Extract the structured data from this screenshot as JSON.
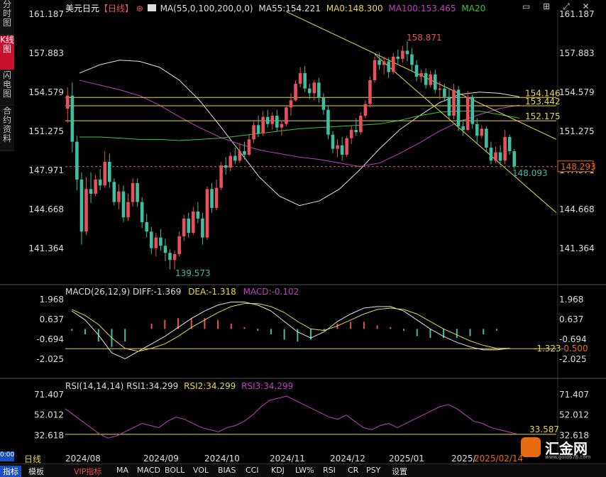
{
  "title": {
    "symbol": "美元日元",
    "period": "【日线】",
    "ma_param": "MA(55,0,100,200,0,0)"
  },
  "ma_values": {
    "ma55": "MA55:154.221",
    "ma0": "MA0:148.300",
    "ma100": "MA100:153.465",
    "ma20": "MA20"
  },
  "side_tabs": [
    "分时图",
    "K线图",
    "闪电图",
    "合约资料"
  ],
  "side_small": "0:00",
  "bottom_label": "日线",
  "toolbar_tabs": [
    "指标",
    "模板",
    "VIP指标",
    "MA",
    "MACD",
    "BOLL",
    "VOL",
    "BIAS",
    "CCI",
    "KDJ",
    "LW%",
    "RSI",
    "CR",
    "PSY",
    "设置"
  ],
  "x_ticks": [
    "2024/08",
    "2024/09",
    "2024/10",
    "2024/11",
    "2024/12",
    "2025/01",
    "2025/",
    "2025/02/14"
  ],
  "main_ticks": [
    "161.187",
    "157.883",
    "154.579",
    "151.275",
    "147.971",
    "144.668",
    "141.364"
  ],
  "hlines": [
    "154.146",
    "153.442",
    "152.175"
  ],
  "current_price": "148.293",
  "annotations": {
    "high": "158.871",
    "low": "139.573",
    "last_low": "148.093"
  },
  "macd": {
    "header": "MACD(26,12,9)",
    "diff": "DIFF:-1.369",
    "dea": "DEA:-1.318",
    "macd": "MACD:-0.102",
    "ticks": [
      "1.968",
      "0.637",
      "-0.694",
      "-2.025"
    ],
    "level": "-1.323",
    "level2": "-0.500"
  },
  "rsi": {
    "header": "RSI(14,14,14)",
    "rsi1": "RSI1:34.299",
    "rsi2": "RSI2:34.299",
    "rsi3": "RSI3:34.299",
    "ticks": [
      "71.407",
      "52.012",
      "32.618"
    ],
    "level": "33.587"
  },
  "logo": {
    "text": "汇金网",
    "site": "www.gold678.com"
  },
  "colors": {
    "up": "#e8505b",
    "down": "#3fbf9f",
    "ma55": "#e0e0e0",
    "ma100": "#c040c0",
    "ma20": "#37c837",
    "hline": "#e6d84a",
    "channel": "#e6d84a",
    "accent": "#c8102e",
    "dashed": "#d07a3a"
  },
  "chart_data": {
    "type": "candlestick",
    "period": "daily",
    "x_range": [
      "2024/07",
      "2025/02/14"
    ],
    "ylim": [
      139.5,
      161.2
    ],
    "ohlc": [
      [
        153.2,
        155.0,
        152.0,
        154.3
      ],
      [
        154.3,
        155.4,
        149.5,
        150.4
      ],
      [
        150.4,
        150.9,
        146.3,
        147.2
      ],
      [
        147.2,
        147.8,
        141.7,
        142.8
      ],
      [
        142.8,
        147.4,
        142.5,
        146.4
      ],
      [
        146.4,
        147.8,
        145.2,
        146.0
      ],
      [
        146.0,
        147.6,
        145.8,
        147.2
      ],
      [
        147.2,
        148.1,
        146.3,
        146.7
      ],
      [
        146.7,
        149.6,
        146.5,
        148.7
      ],
      [
        148.7,
        149.4,
        146.5,
        147.0
      ],
      [
        147.0,
        147.3,
        145.0,
        145.3
      ],
      [
        145.3,
        146.8,
        144.7,
        146.2
      ],
      [
        146.2,
        146.7,
        143.6,
        144.0
      ],
      [
        144.0,
        146.0,
        143.7,
        145.3
      ],
      [
        145.3,
        147.3,
        144.9,
        146.9
      ],
      [
        146.9,
        147.3,
        144.9,
        145.3
      ],
      [
        145.3,
        145.7,
        143.1,
        143.6
      ],
      [
        143.6,
        144.3,
        142.3,
        142.8
      ],
      [
        142.8,
        143.2,
        140.9,
        141.4
      ],
      [
        141.4,
        142.7,
        140.7,
        142.3
      ],
      [
        142.3,
        143.0,
        141.2,
        141.6
      ],
      [
        141.6,
        142.2,
        140.3,
        141.0
      ],
      [
        141.0,
        141.3,
        139.6,
        140.4
      ],
      [
        140.4,
        141.2,
        139.6,
        140.9
      ],
      [
        140.9,
        142.8,
        140.7,
        142.4
      ],
      [
        142.4,
        144.2,
        142.0,
        143.9
      ],
      [
        143.9,
        144.4,
        142.3,
        142.7
      ],
      [
        142.7,
        144.9,
        142.5,
        144.5
      ],
      [
        144.5,
        145.3,
        143.5,
        143.9
      ],
      [
        143.9,
        144.4,
        141.7,
        142.3
      ],
      [
        142.3,
        146.6,
        142.1,
        146.4
      ],
      [
        146.4,
        146.9,
        144.4,
        144.8
      ],
      [
        144.8,
        147.2,
        144.6,
        146.5
      ],
      [
        146.5,
        148.7,
        146.3,
        148.4
      ],
      [
        148.4,
        149.1,
        147.6,
        148.2
      ],
      [
        148.2,
        149.5,
        147.9,
        149.2
      ],
      [
        149.2,
        149.9,
        148.5,
        148.8
      ],
      [
        148.8,
        150.3,
        148.6,
        149.6
      ],
      [
        149.6,
        150.4,
        148.9,
        149.3
      ],
      [
        149.3,
        151.0,
        149.2,
        150.6
      ],
      [
        150.6,
        152.1,
        150.3,
        151.8
      ],
      [
        151.8,
        152.6,
        150.8,
        151.1
      ],
      [
        151.1,
        153.0,
        150.9,
        152.5
      ],
      [
        152.5,
        153.1,
        151.6,
        151.9
      ],
      [
        151.9,
        152.9,
        151.4,
        152.6
      ],
      [
        152.6,
        153.1,
        151.3,
        151.6
      ],
      [
        151.6,
        152.2,
        150.9,
        151.9
      ],
      [
        151.9,
        153.5,
        151.7,
        153.3
      ],
      [
        153.3,
        154.5,
        152.6,
        153.9
      ],
      [
        153.9,
        155.6,
        153.8,
        155.3
      ],
      [
        155.3,
        156.7,
        155.0,
        156.2
      ],
      [
        156.2,
        156.8,
        154.6,
        154.9
      ],
      [
        154.9,
        155.3,
        154.0,
        154.5
      ],
      [
        154.5,
        155.6,
        153.9,
        155.4
      ],
      [
        155.4,
        155.8,
        153.7,
        154.1
      ],
      [
        154.1,
        154.5,
        152.7,
        153.1
      ],
      [
        153.1,
        153.5,
        150.6,
        151.0
      ],
      [
        151.0,
        151.3,
        149.4,
        149.8
      ],
      [
        149.8,
        150.6,
        149.1,
        150.1
      ],
      [
        150.1,
        150.8,
        148.8,
        149.3
      ],
      [
        149.3,
        150.9,
        149.1,
        150.7
      ],
      [
        150.7,
        151.8,
        150.2,
        151.4
      ],
      [
        151.4,
        152.4,
        150.9,
        151.2
      ],
      [
        151.2,
        152.9,
        151.0,
        152.6
      ],
      [
        152.6,
        153.9,
        152.4,
        153.6
      ],
      [
        153.6,
        155.9,
        153.3,
        155.6
      ],
      [
        155.6,
        157.6,
        155.4,
        157.3
      ],
      [
        157.3,
        157.9,
        156.5,
        156.9
      ],
      [
        156.9,
        157.6,
        156.1,
        157.2
      ],
      [
        157.2,
        157.5,
        155.8,
        156.3
      ],
      [
        156.3,
        157.9,
        156.1,
        157.6
      ],
      [
        157.6,
        158.2,
        156.9,
        157.4
      ],
      [
        157.4,
        158.5,
        157.1,
        158.1
      ],
      [
        158.1,
        158.9,
        157.2,
        157.8
      ],
      [
        157.8,
        158.3,
        156.4,
        156.9
      ],
      [
        156.9,
        157.3,
        155.5,
        155.9
      ],
      [
        155.9,
        156.5,
        155.4,
        156.2
      ],
      [
        156.2,
        156.6,
        154.9,
        155.2
      ],
      [
        155.2,
        156.4,
        155.0,
        156.1
      ],
      [
        156.1,
        156.5,
        154.5,
        154.8
      ],
      [
        154.8,
        155.5,
        154.0,
        154.9
      ],
      [
        154.9,
        155.3,
        153.8,
        154.2
      ],
      [
        154.2,
        154.9,
        152.3,
        152.6
      ],
      [
        152.6,
        155.3,
        152.3,
        154.8
      ],
      [
        154.8,
        155.1,
        151.3,
        151.7
      ],
      [
        151.7,
        152.3,
        150.9,
        151.4
      ],
      [
        151.4,
        154.7,
        151.3,
        154.2
      ],
      [
        154.2,
        154.4,
        151.5,
        151.9
      ],
      [
        151.9,
        152.4,
        150.3,
        150.9
      ],
      [
        150.9,
        151.8,
        150.7,
        151.5
      ],
      [
        151.5,
        151.7,
        149.6,
        149.9
      ],
      [
        149.9,
        150.4,
        148.5,
        148.8
      ],
      [
        148.8,
        150.0,
        148.6,
        149.5
      ],
      [
        149.5,
        150.1,
        148.4,
        148.8
      ],
      [
        148.8,
        151.4,
        148.5,
        150.8
      ],
      [
        150.8,
        151.0,
        149.3,
        149.6
      ],
      [
        149.6,
        149.8,
        148.1,
        148.3
      ]
    ],
    "channel": {
      "upper": [
        [
          0.45,
          161.4
        ],
        [
          1.0,
          150.6
        ]
      ],
      "lower": [
        [
          0.63,
          157.8
        ],
        [
          1.0,
          144.4
        ]
      ]
    },
    "levels": [
      154.146,
      153.442,
      152.175
    ],
    "ma55": [
      156.2,
      156.9,
      157.3,
      157.2,
      156.7,
      155.6,
      153.9,
      151.8,
      149.6,
      147.4,
      145.8,
      145.0,
      145.4,
      146.4,
      148.0,
      149.8,
      151.4,
      152.6,
      153.7,
      154.4,
      154.6,
      154.5,
      154.2
    ],
    "ma100": [
      155.6,
      155.2,
      154.8,
      154.3,
      153.5,
      152.5,
      151.6,
      150.8,
      150.2,
      149.7,
      149.4,
      149.1,
      148.9,
      148.6,
      148.3,
      148.6,
      149.4,
      150.3,
      151.3,
      152.1,
      152.7,
      153.2,
      153.5
    ],
    "ma20": [
      150.8,
      150.8,
      150.7,
      150.6,
      150.6,
      150.5,
      150.6,
      150.7,
      150.9,
      151.1,
      151.3,
      151.5,
      151.6,
      151.7,
      151.8,
      151.9,
      152.2,
      152.6,
      152.9,
      153.0,
      153.0,
      152.7,
      152.4
    ],
    "macd_diff": [
      1.2,
      0.6,
      -0.4,
      -1.6,
      -2.0,
      -1.5,
      -1.0,
      -0.5,
      0.1,
      0.7,
      1.2,
      1.6,
      1.8,
      1.8,
      1.6,
      1.2,
      0.5,
      -0.2,
      -0.6,
      -0.2,
      0.5,
      1.0,
      1.4,
      1.5,
      1.5,
      1.2,
      0.6,
      0.0,
      -0.5,
      -0.9,
      -1.2,
      -1.4,
      -1.4,
      -1.3
    ],
    "macd_dea": [
      1.3,
      0.9,
      0.3,
      -0.6,
      -1.3,
      -1.5,
      -1.3,
      -1.0,
      -0.5,
      0.1,
      0.6,
      1.1,
      1.5,
      1.7,
      1.7,
      1.5,
      1.1,
      0.5,
      0.0,
      -0.1,
      0.2,
      0.6,
      1.0,
      1.3,
      1.4,
      1.3,
      1.0,
      0.5,
      0.0,
      -0.4,
      -0.8,
      -1.1,
      -1.3,
      -1.3
    ],
    "rsi1": [
      58,
      52,
      46,
      40,
      34,
      30,
      32,
      36,
      40,
      44,
      42,
      40,
      46,
      50,
      48,
      44,
      40,
      38,
      36,
      40,
      42,
      46,
      52,
      60,
      66,
      68,
      70,
      66,
      62,
      58,
      54,
      50,
      48,
      52,
      46,
      40,
      38,
      42,
      44,
      40,
      44,
      48,
      52,
      56,
      60,
      62,
      58,
      52,
      46,
      44,
      40,
      38,
      36,
      34
    ]
  }
}
